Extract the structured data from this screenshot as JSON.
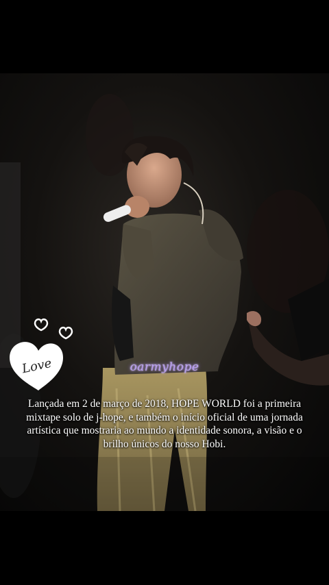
{
  "post": {
    "watermark": "oarmyhope",
    "caption": "Lançada em 2 de março de 2018, HOPE WORLD foi a primeira mixtape solo de j-hope, e também o início oficial de uma jornada artística que mostraria ao mundo a identidade sonora, a visão e o brilho únicos do nosso Hobi.",
    "sticker_text": "Love"
  },
  "colors": {
    "background": "#000000",
    "caption_text": "#ffffff",
    "watermark": "#b89df0",
    "hoodie": "#4a4538",
    "pants": "#8f7f52"
  },
  "icons": {
    "sticker": "love-heart-sticker",
    "small_hearts": "heart-outline-icon"
  }
}
